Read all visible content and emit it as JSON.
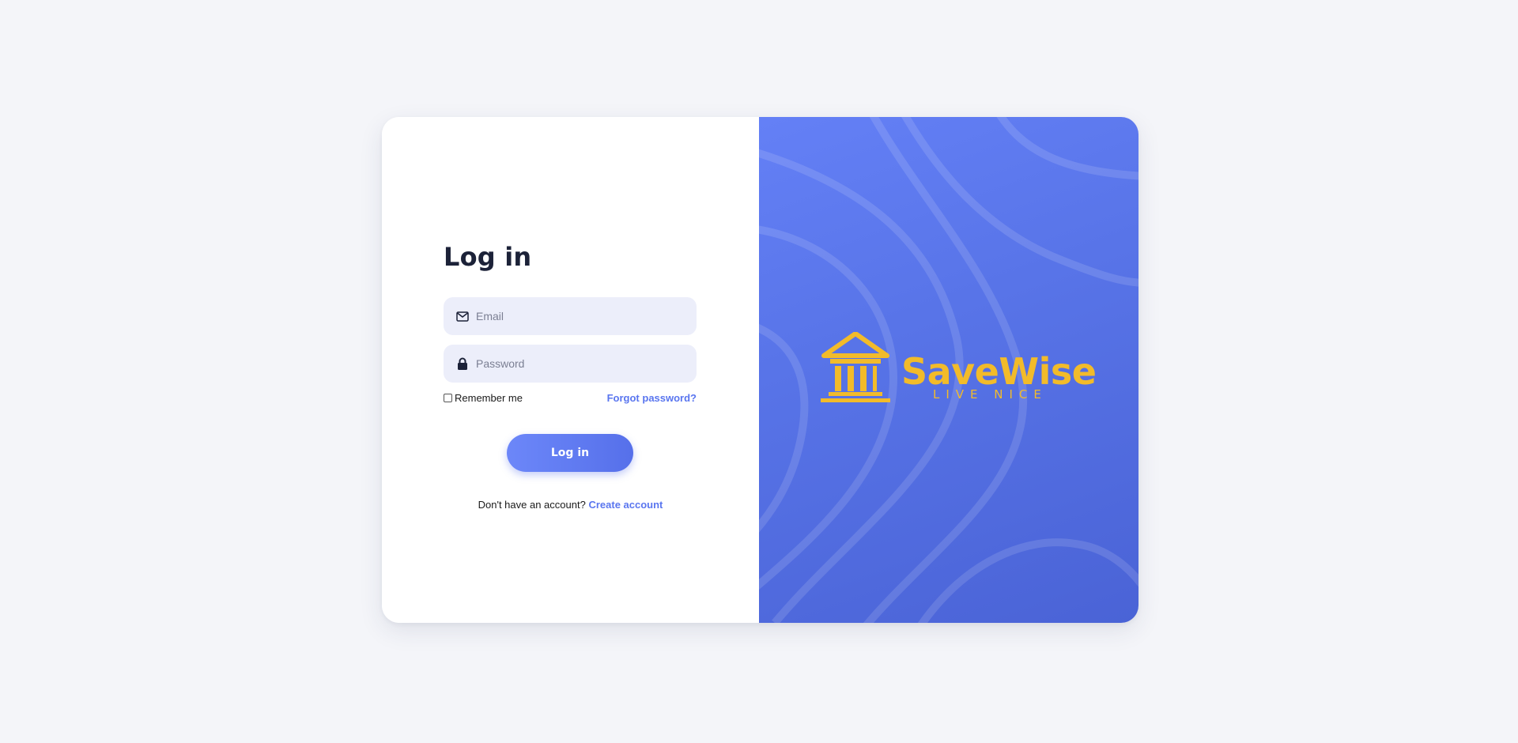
{
  "login": {
    "title": "Log in",
    "email_placeholder": "Email",
    "password_placeholder": "Password",
    "remember_label": "Remember me",
    "forgot_label": "Forgot password?",
    "submit_label": "Log in",
    "signup_prompt": "Don't have an account?",
    "signup_link": "Create account"
  },
  "brand": {
    "name": "SaveWise",
    "tagline": "LIVE NICE",
    "logo_icon": "bank-building-icon"
  },
  "colors": {
    "accent": "#5a76ef",
    "brand_panel": "#5874e8",
    "brand_gold": "#f2bb2a",
    "input_bg": "#eceefa",
    "title": "#1c2238",
    "page_bg": "#f4f5f9"
  },
  "icons": {
    "email": "envelope-icon",
    "password": "lock-icon"
  }
}
